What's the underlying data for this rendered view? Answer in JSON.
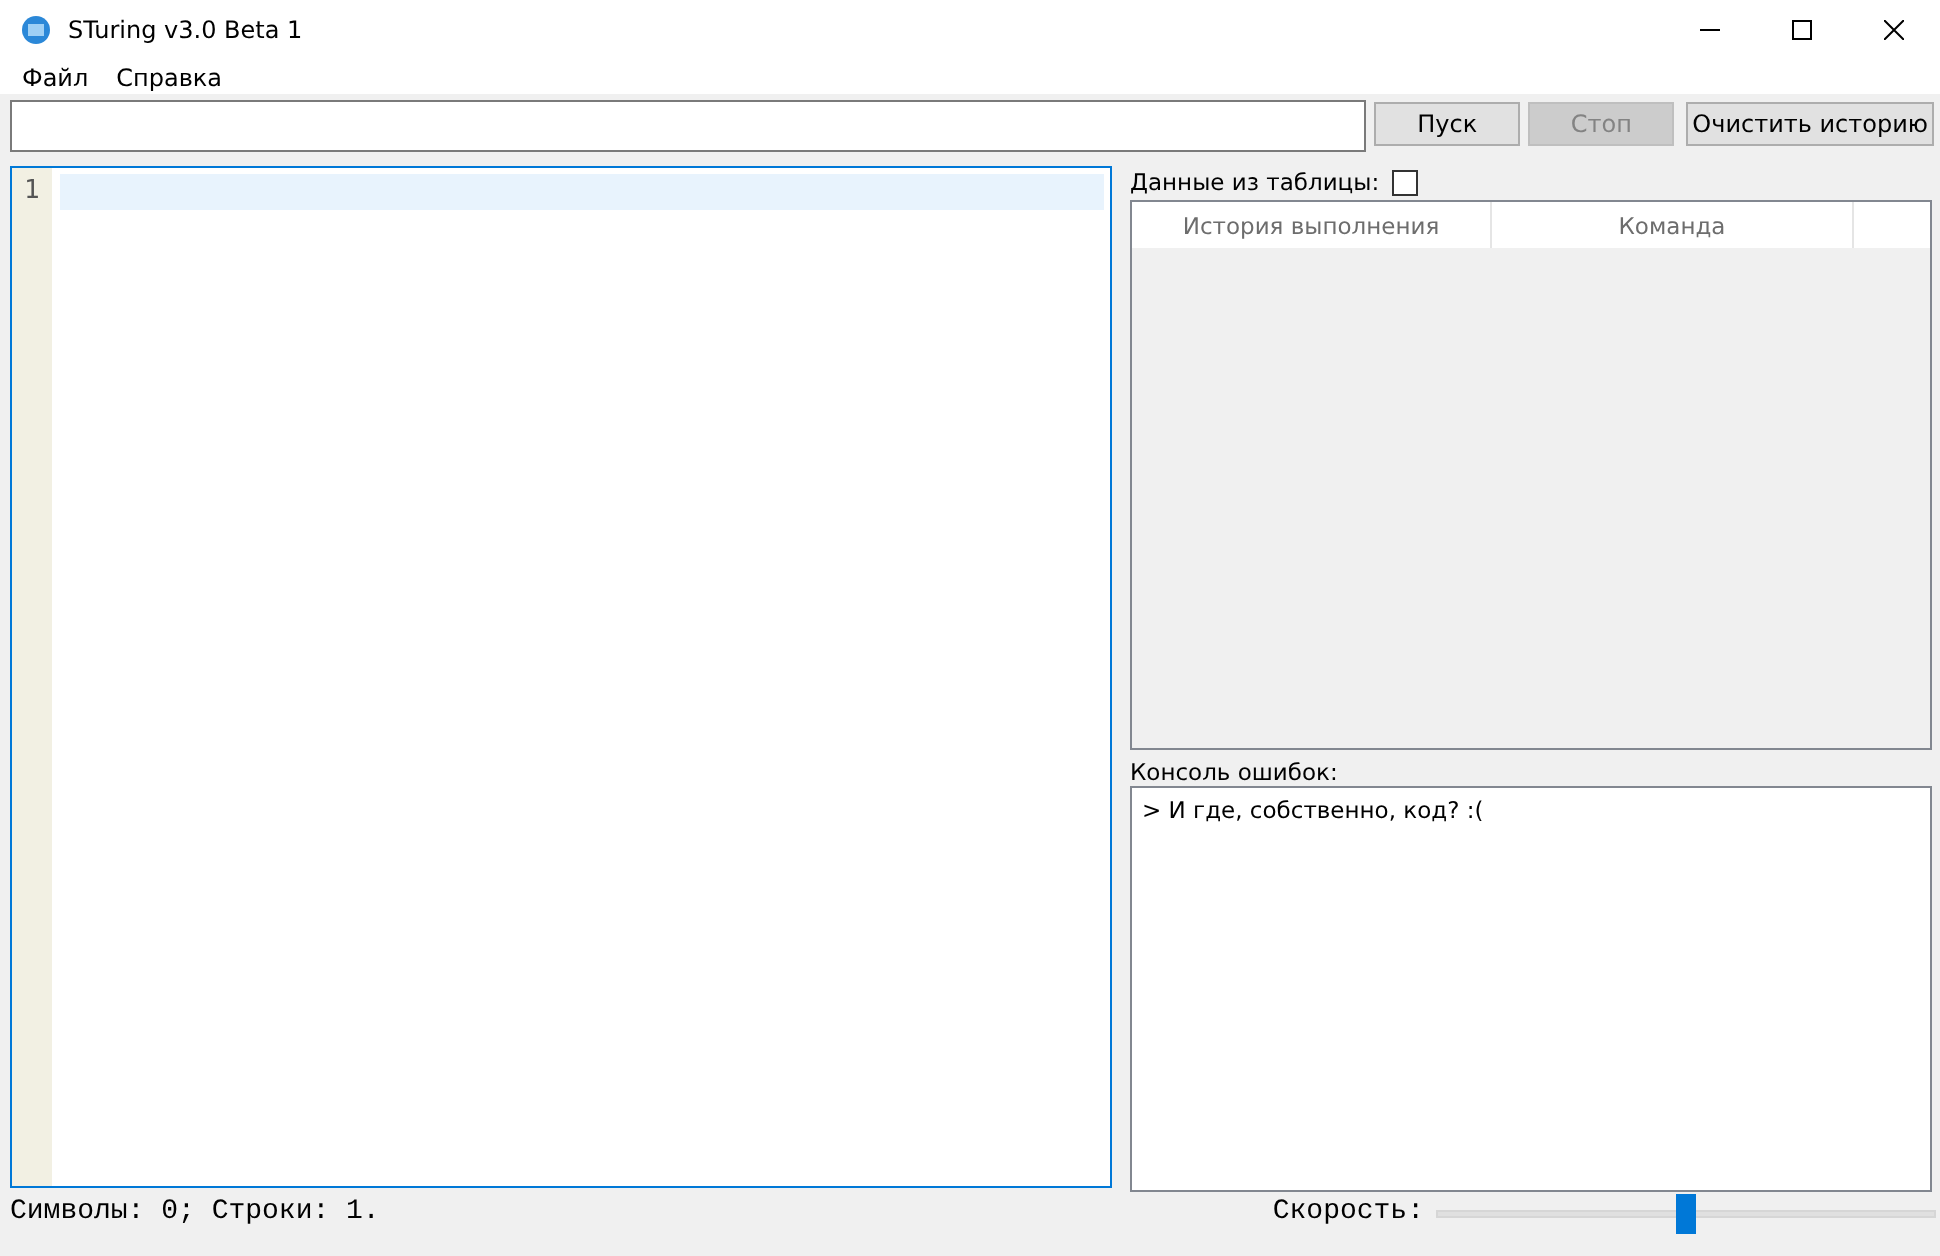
{
  "window": {
    "title": "STuring v3.0 Beta 1"
  },
  "menu": [
    {
      "label": "Файл"
    },
    {
      "label": "Справка"
    }
  ],
  "toolbar": {
    "buttons": [
      {
        "label": "Пуск",
        "disabled": false
      },
      {
        "label": "Стоп",
        "disabled": true
      },
      {
        "label": "Очистить историю",
        "disabled": false
      }
    ]
  },
  "editor": {
    "lines": [
      {
        "number": "1",
        "current": true
      }
    ]
  },
  "table_data": {
    "label": "Данные из таблицы:",
    "checked": false
  },
  "history_table": {
    "columns": [
      "История выполнения",
      "Команда"
    ]
  },
  "console": {
    "label": "Консоль ошибок:",
    "lines": [
      "> И где, собственно, код? :("
    ]
  },
  "status_bar": {
    "stats": "Символы: 0; Строки: 1.",
    "speed_label": "Скорость:",
    "speed": {
      "level": 0.5
    }
  }
}
